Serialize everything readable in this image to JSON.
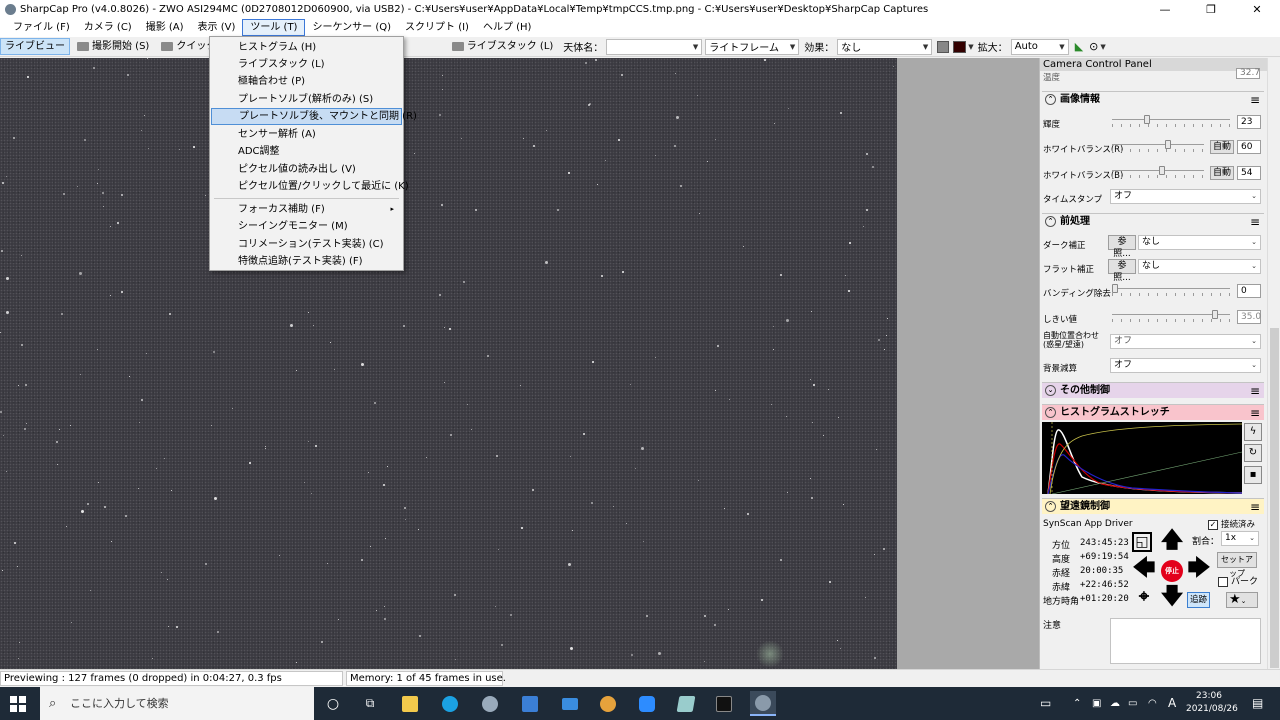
{
  "titlebar": {
    "title": "SharpCap Pro (v4.0.8026) - ZWO ASI294MC (0D2708012D060900, via USB2) - C:¥Users¥user¥AppData¥Local¥Temp¥tmpCCS.tmp.png - C:¥Users¥user¥Desktop¥SharpCap Captures",
    "minimize": "—",
    "maximize": "❐",
    "close": "✕"
  },
  "menubar": [
    "ファイル (F)",
    "カメラ (C)",
    "撮影 (A)",
    "表示 (V)",
    "ツール (T)",
    "シーケンサー (Q)",
    "スクリプト (I)",
    "ヘルプ (H)"
  ],
  "toolbar": {
    "live_view": "ライブビュー",
    "start_capture": "撮影開始 (S)",
    "quick_capture": "クイック撮影",
    "live_stack": "ライブスタック (L)",
    "object_name_label": "天体名：",
    "object_name_value": "",
    "frame_type": "ライトフレーム",
    "effect_label": "効果：",
    "effect_value": "なし",
    "zoom_label": "拡大：",
    "zoom_value": "Auto"
  },
  "tools_menu": {
    "items": [
      "ヒストグラム (H)",
      "ライブスタック (L)",
      "極軸合わせ (P)",
      "プレートソルブ(解析のみ) (S)",
      "プレートソルブ後、マウントと同期 (R)",
      "センサー解析 (A)",
      "ADC調整",
      "ピクセル値の読み出し (V)",
      "ピクセル位置/クリックして最近に (K)"
    ],
    "items2": [
      "フォーカス補助 (F)",
      "シーイングモニター (M)",
      "コリメーション(テスト実装) (C)",
      "特徴点追跡(テスト実装) (F)"
    ],
    "submenu_arrow": "▸"
  },
  "status": {
    "preview": "Previewing : 127 frames (0 dropped) in 0:04:27, 0.3 fps",
    "memory": "Memory: 1 of 45 frames in use."
  },
  "panel": {
    "header": "Camera Control Panel",
    "temp_label": "温度",
    "temp_value": "32.7",
    "image_info": {
      "title": "画像情報",
      "brightness_label": "輝度",
      "brightness_value": "23",
      "wb_r_label": "ホワイトバランス(R)",
      "wb_r_auto": "自動",
      "wb_r_value": "60",
      "wb_b_label": "ホワイトバランス(B)",
      "wb_b_auto": "自動",
      "wb_b_value": "54",
      "timestamp_label": "タイムスタンプ",
      "timestamp_value": "オフ"
    },
    "preprocess": {
      "title": "前処理",
      "dark_label": "ダーク補正",
      "dark_browse": "参照...",
      "dark_value": "なし",
      "flat_label": "フラット補正",
      "flat_browse": "参照...",
      "flat_value": "なし",
      "banding_label": "バンディング除去",
      "banding_value": "0",
      "threshold_label": "しきい値",
      "threshold_value": "35.0",
      "align_label": "自動位置合わせ(惑星/望遠)",
      "align_value": "オフ",
      "bg_label": "背景減算",
      "bg_value": "オフ"
    },
    "other": {
      "title": "その他制御"
    },
    "histogram": {
      "title": "ヒストグラムストレッチ"
    },
    "telescope": {
      "title": "望遠鏡制御",
      "driver": "SynScan App Driver",
      "connected_label": "接続済み",
      "rate_label": "割合：",
      "rate_value": "1x",
      "az_label": "方位",
      "az_value": "243:45:23",
      "alt_label": "高度",
      "alt_value": "+69:19:54",
      "ra_label": "赤経",
      "ra_value": "20:00:35",
      "dec_label": "赤緯",
      "dec_value": "+22:46:52",
      "ha_label": "地方時角",
      "ha_value": "+01:20:20",
      "stop": "停止",
      "setup": "セットアップ",
      "park": "パーク",
      "track": "追跡",
      "notes_label": "注意"
    }
  },
  "taskbar": {
    "search_placeholder": "ここに入力して検索",
    "time": "23:06",
    "date": "2021/08/26",
    "ime": "A"
  },
  "colors": {
    "histogram_section": "#f9c4cc",
    "telescope_section": "#fff3c4",
    "other_section": "#e6d4ea",
    "stop_button": "#e3001b"
  }
}
